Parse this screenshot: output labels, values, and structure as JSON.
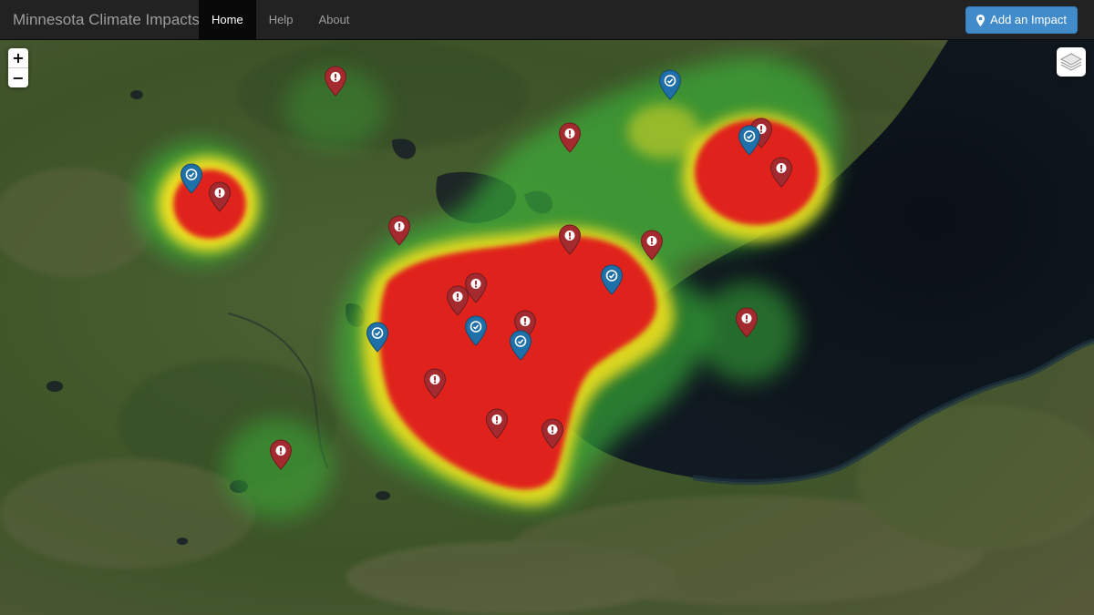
{
  "app": {
    "title": "Minnesota Climate Impacts"
  },
  "nav": {
    "items": [
      {
        "label": "Home",
        "active": true
      },
      {
        "label": "Help",
        "active": false
      },
      {
        "label": "About",
        "active": false
      }
    ]
  },
  "actions": {
    "add_label": "Add an Impact",
    "add_icon": "map-pin-icon",
    "add_color": "#428bca"
  },
  "map_controls": {
    "zoom_in": "+",
    "zoom_out": "−",
    "layers_icon": "layers-icon"
  },
  "marker_types": {
    "alert": {
      "color": "#a32a2e",
      "icon": "exclamation-icon"
    },
    "check": {
      "color": "#1f6fa8",
      "icon": "check-circle-icon"
    }
  },
  "heatmap_colors": {
    "high": "#e0231c",
    "mid": "#f0e020",
    "low": "#3bbf3b"
  }
}
